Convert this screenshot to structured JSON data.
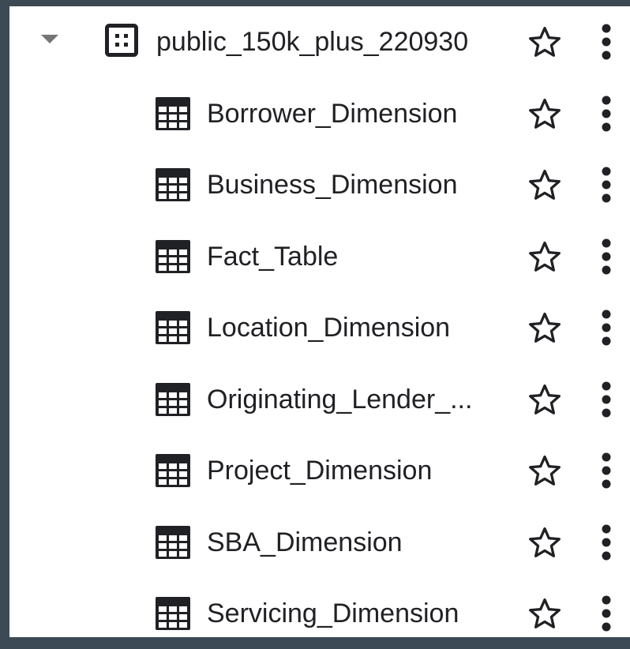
{
  "dataset": {
    "name": "public_150k_plus_220930",
    "expand_icon": "caret-down-icon",
    "type_icon": "dataset-icon",
    "star_icon": "star-outline-icon",
    "menu_icon": "more-vert-icon"
  },
  "tables": [
    {
      "label": "Borrower_Dimension"
    },
    {
      "label": "Business_Dimension"
    },
    {
      "label": "Fact_Table"
    },
    {
      "label": "Location_Dimension"
    },
    {
      "label": "Originating_Lender_..."
    },
    {
      "label": "Project_Dimension"
    },
    {
      "label": "SBA_Dimension"
    },
    {
      "label": "Servicing_Dimension"
    }
  ],
  "colors": {
    "background": "#3c4a56",
    "panel": "#ffffff",
    "text": "#202124",
    "icon": "#202124",
    "caret": "#757575"
  }
}
